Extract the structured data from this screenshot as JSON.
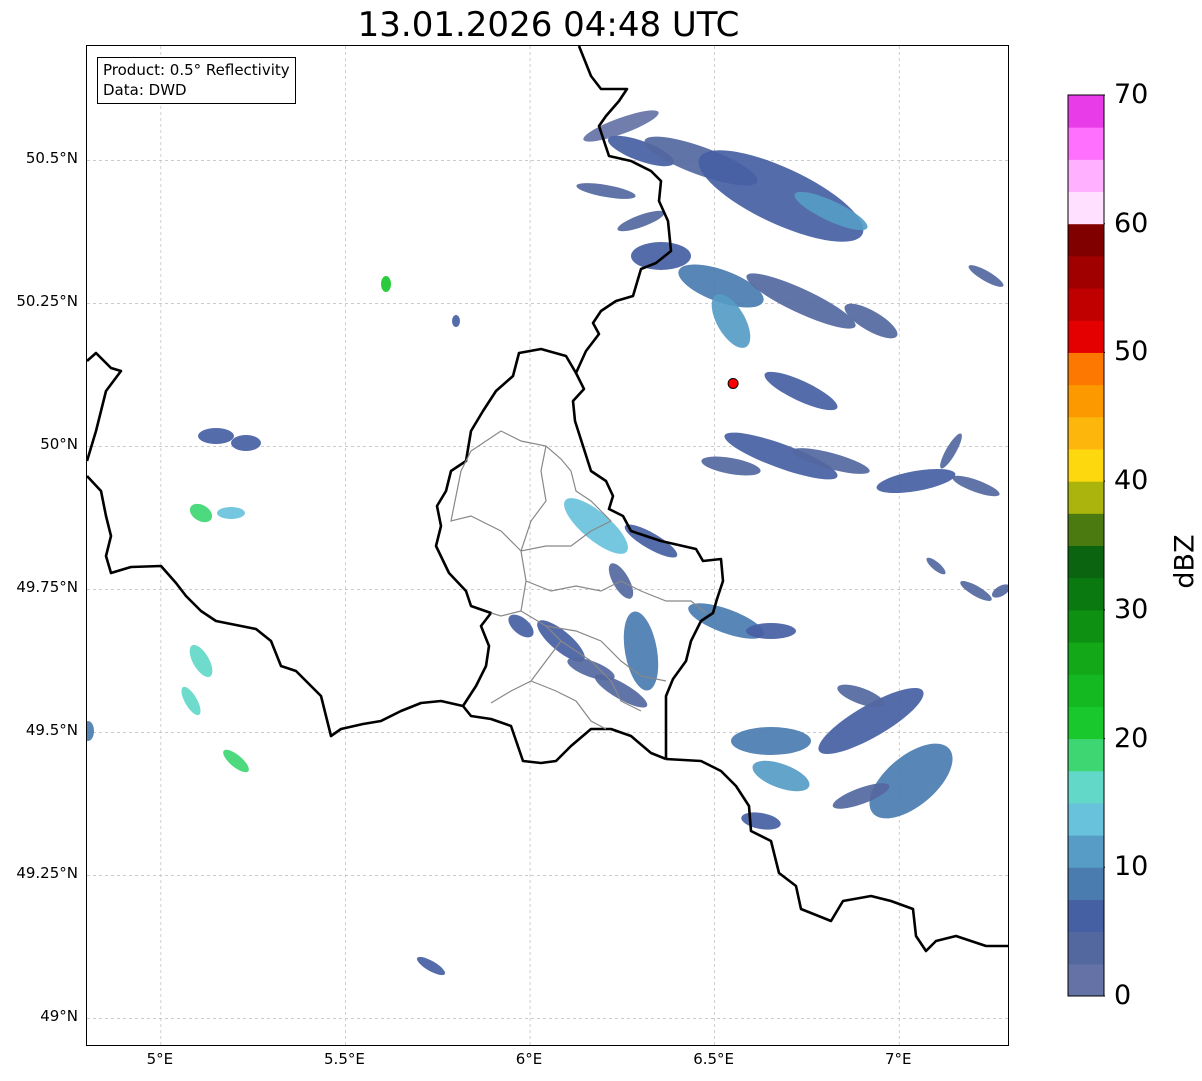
{
  "title": "13.01.2026 04:48 UTC",
  "info": {
    "line1": "Product: 0.5° Reflectivity",
    "line2": "Data: DWD"
  },
  "axes": {
    "lat_labels": [
      "50.5°N",
      "50.25°N",
      "50°N",
      "49.75°N",
      "49.5°N",
      "49.25°N",
      "49°N"
    ],
    "lat_values": [
      50.5,
      50.25,
      50.0,
      49.75,
      49.5,
      49.25,
      49.0
    ],
    "lon_labels": [
      "5°E",
      "5.5°E",
      "6°E",
      "6.5°E",
      "7°E"
    ],
    "lon_values": [
      5.0,
      5.5,
      6.0,
      6.5,
      7.0
    ],
    "lon_range": [
      4.8,
      7.3
    ],
    "lat_range": [
      48.95,
      50.7
    ]
  },
  "colorbar": {
    "label": "dBZ",
    "tick_labels": [
      "0",
      "10",
      "20",
      "30",
      "40",
      "50",
      "60",
      "70"
    ],
    "tick_values": [
      0,
      10,
      20,
      30,
      40,
      50,
      60,
      70
    ],
    "range": [
      0,
      70
    ],
    "step": 2.5,
    "colors": [
      "#6472a6",
      "#5468a0",
      "#4660a4",
      "#4a7cb0",
      "#569cc6",
      "#68c2dc",
      "#62d8c8",
      "#3ed672",
      "#18c82c",
      "#14b820",
      "#12a818",
      "#0e9012",
      "#0a7a10",
      "#0a6410",
      "#4a7a10",
      "#aab40c",
      "#fed80e",
      "#fdb60c",
      "#fc9800",
      "#fc7800",
      "#e40000",
      "#c00000",
      "#a00000",
      "#800000",
      "#ffe0ff",
      "#ffb0ff",
      "#ff70ff",
      "#e83ce8"
    ]
  },
  "marker": {
    "lat": 50.11,
    "lon": 6.55,
    "color": "#ff0000"
  },
  "colors": {
    "border": "#000000",
    "admin_border": "#888888",
    "grid": "#bbbbbb"
  }
}
